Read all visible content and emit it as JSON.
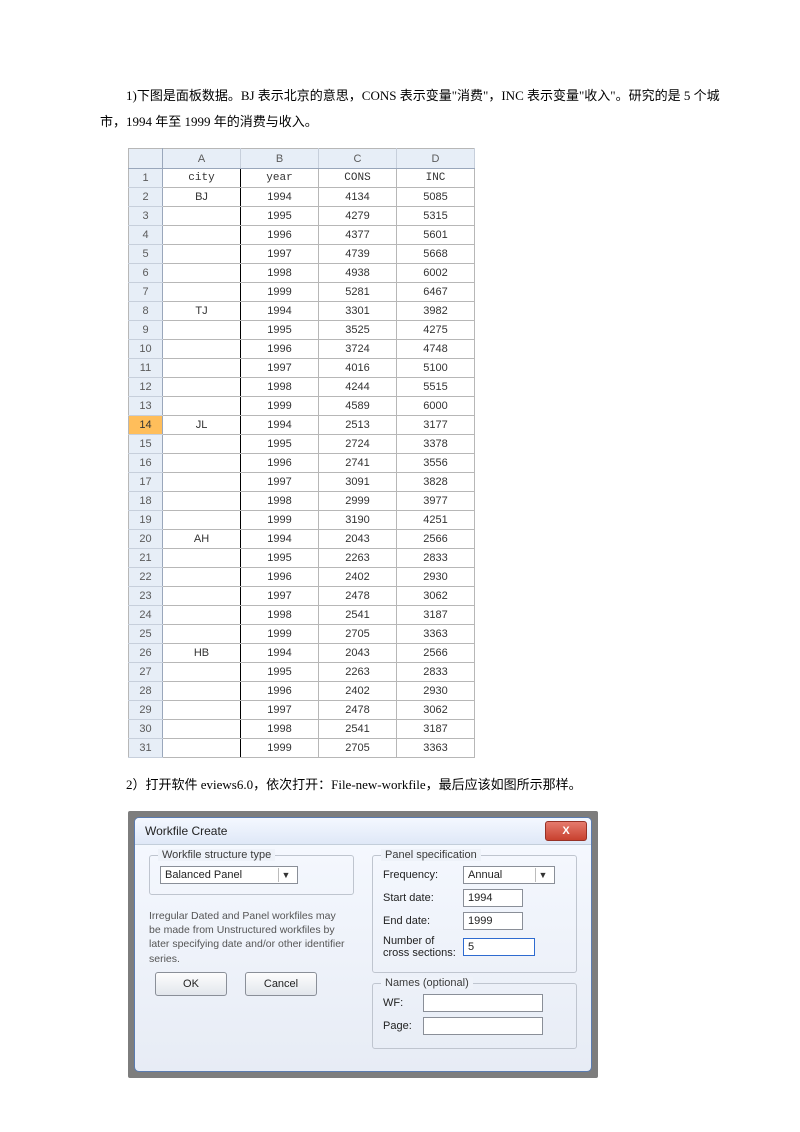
{
  "para1": "1)下图是面板数据。BJ 表示北京的意思，CONS 表示变量\"消费\"，INC 表示变量\"收入\"。研究的是 5 个城市，1994 年至 1999 年的消费与收入。",
  "para2": "2）打开软件 eviews6.0，依次打开：File-new-workfile，最后应该如图所示那样。",
  "sheet": {
    "cols": [
      "A",
      "B",
      "C",
      "D"
    ],
    "headerRow": [
      "city",
      "year",
      "CONS",
      "INC"
    ],
    "rows": [
      [
        "BJ",
        "1994",
        "4134",
        "5085"
      ],
      [
        "",
        "1995",
        "4279",
        "5315"
      ],
      [
        "",
        "1996",
        "4377",
        "5601"
      ],
      [
        "",
        "1997",
        "4739",
        "5668"
      ],
      [
        "",
        "1998",
        "4938",
        "6002"
      ],
      [
        "",
        "1999",
        "5281",
        "6467"
      ],
      [
        "TJ",
        "1994",
        "3301",
        "3982"
      ],
      [
        "",
        "1995",
        "3525",
        "4275"
      ],
      [
        "",
        "1996",
        "3724",
        "4748"
      ],
      [
        "",
        "1997",
        "4016",
        "5100"
      ],
      [
        "",
        "1998",
        "4244",
        "5515"
      ],
      [
        "",
        "1999",
        "4589",
        "6000"
      ],
      [
        "JL",
        "1994",
        "2513",
        "3177"
      ],
      [
        "",
        "1995",
        "2724",
        "3378"
      ],
      [
        "",
        "1996",
        "2741",
        "3556"
      ],
      [
        "",
        "1997",
        "3091",
        "3828"
      ],
      [
        "",
        "1998",
        "2999",
        "3977"
      ],
      [
        "",
        "1999",
        "3190",
        "4251"
      ],
      [
        "AH",
        "1994",
        "2043",
        "2566"
      ],
      [
        "",
        "1995",
        "2263",
        "2833"
      ],
      [
        "",
        "1996",
        "2402",
        "2930"
      ],
      [
        "",
        "1997",
        "2478",
        "3062"
      ],
      [
        "",
        "1998",
        "2541",
        "3187"
      ],
      [
        "",
        "1999",
        "2705",
        "3363"
      ],
      [
        "HB",
        "1994",
        "2043",
        "2566"
      ],
      [
        "",
        "1995",
        "2263",
        "2833"
      ],
      [
        "",
        "1996",
        "2402",
        "2930"
      ],
      [
        "",
        "1997",
        "2478",
        "3062"
      ],
      [
        "",
        "1998",
        "2541",
        "3187"
      ],
      [
        "",
        "1999",
        "2705",
        "3363"
      ]
    ],
    "highlightRow": 14
  },
  "dialog": {
    "title": "Workfile Create",
    "close": "X",
    "structType": {
      "legend": "Workfile structure type",
      "value": "Balanced Panel"
    },
    "help": "Irregular Dated and Panel workfiles may be made from Unstructured workfiles by later specifying date and/or other identifier series.",
    "panel": {
      "legend": "Panel specification",
      "freqLabel": "Frequency:",
      "freqValue": "Annual",
      "startLabel": "Start date:",
      "startValue": "1994",
      "endLabel": "End date:",
      "endValue": "1999",
      "nsecLabel1": "Number of",
      "nsecLabel2": "cross sections:",
      "nsecValue": "5"
    },
    "names": {
      "legend": "Names (optional)",
      "wfLabel": "WF:",
      "wfValue": "",
      "pageLabel": "Page:",
      "pageValue": ""
    },
    "ok": "OK",
    "cancel": "Cancel"
  }
}
